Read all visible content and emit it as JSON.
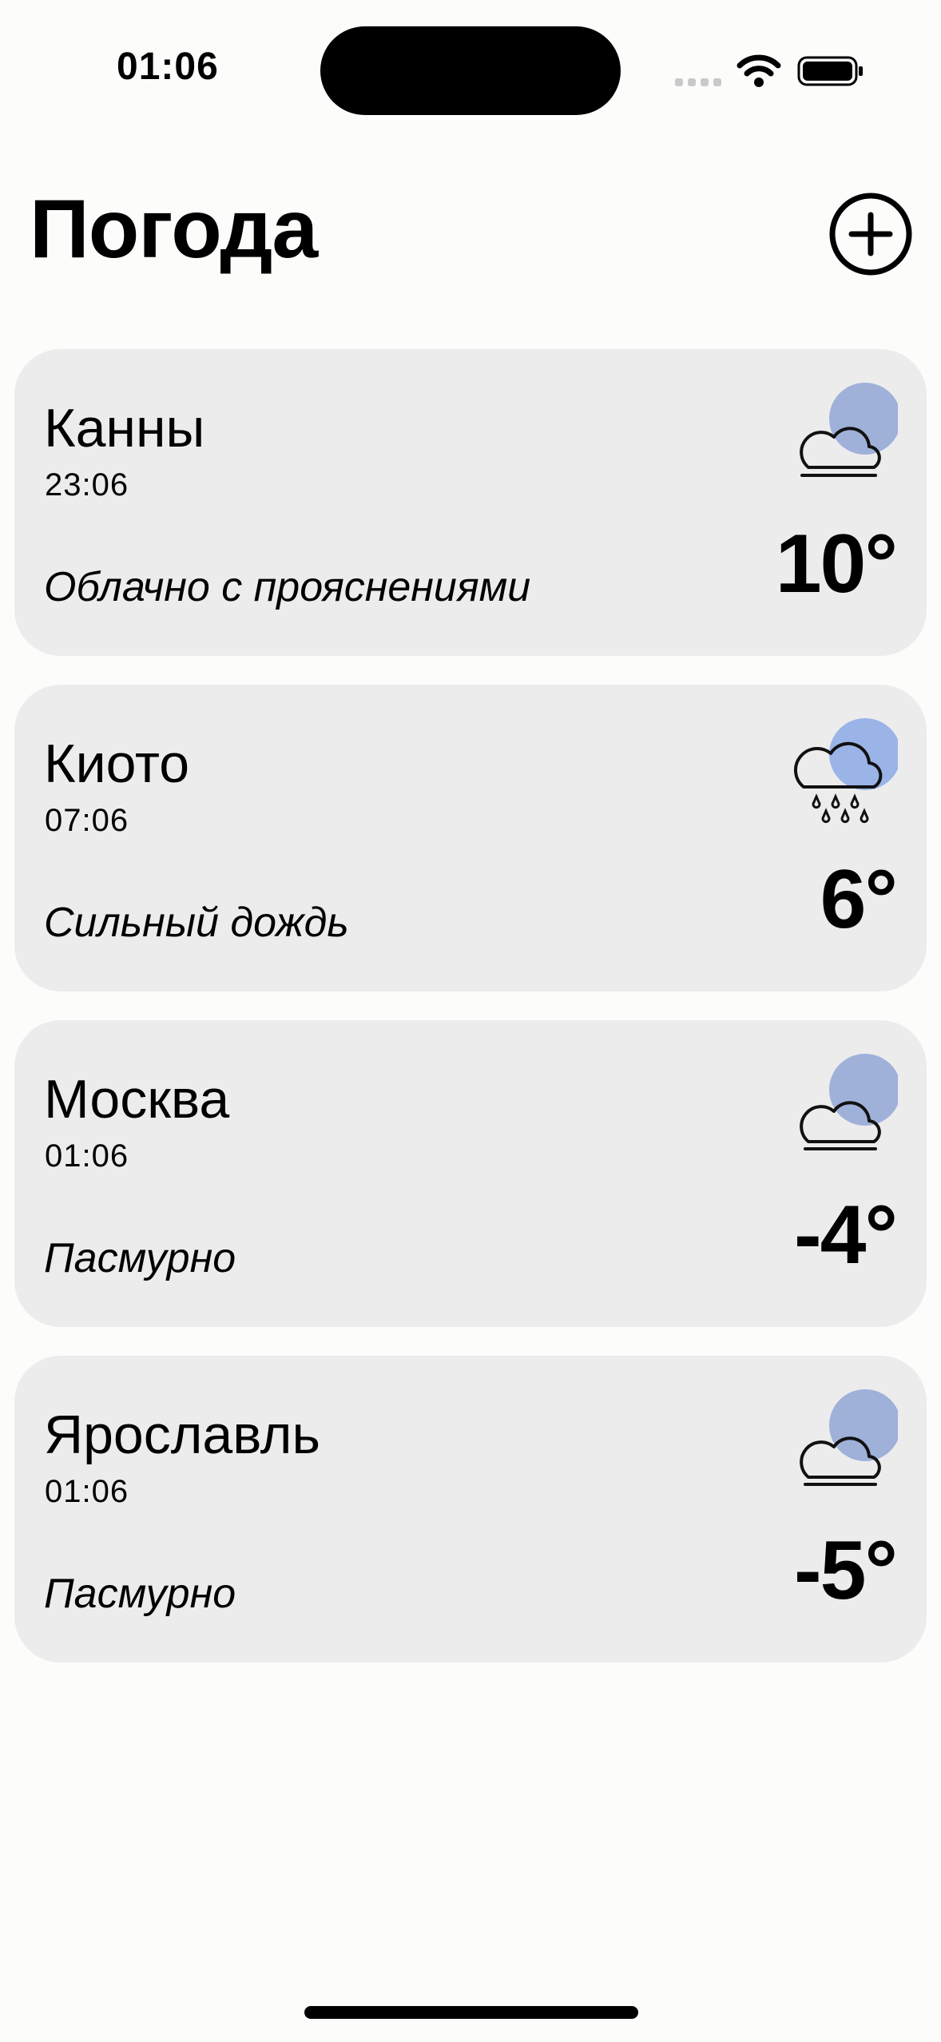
{
  "status_bar": {
    "time": "01:06"
  },
  "header": {
    "title": "Погода",
    "add_icon": "plus-circle-icon"
  },
  "cities": [
    {
      "name": "Канны",
      "time": "23:06",
      "condition": "Облачно с прояснениями",
      "temperature": "10°",
      "icon": "partly-cloudy-icon"
    },
    {
      "name": "Киото",
      "time": "07:06",
      "condition": "Сильный дождь",
      "temperature": "6°",
      "icon": "heavy-rain-icon"
    },
    {
      "name": "Москва",
      "time": "01:06",
      "condition": "Пасмурно",
      "temperature": "-4°",
      "icon": "cloudy-icon"
    },
    {
      "name": "Ярославль",
      "time": "01:06",
      "condition": "Пасмурно",
      "temperature": "-5°",
      "icon": "cloudy-icon"
    }
  ],
  "colors": {
    "background": "#fcfcfb",
    "card": "#ececec",
    "sun_accent": "#9fb0d9",
    "rain_accent": "#9ab4e8"
  }
}
